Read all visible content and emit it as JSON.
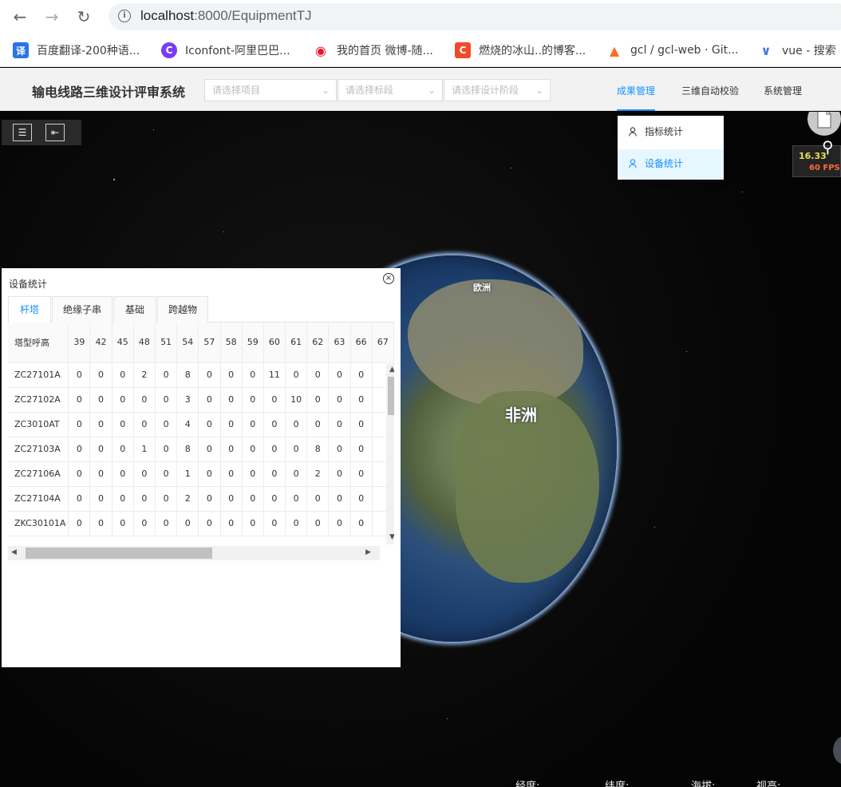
{
  "browser": {
    "url_host": "localhost",
    "url_path": ":8000/EquipmentTJ",
    "bookmarks": [
      {
        "label": "百度翻译-200种语...",
        "icon": "baidu-translate-icon",
        "color": "#2a73e8"
      },
      {
        "label": "Iconfont-阿里巴巴...",
        "icon": "iconfont-icon",
        "color": "#7b3cf2"
      },
      {
        "label": "我的首页 微博-随...",
        "icon": "weibo-icon",
        "color": "#e6162d"
      },
      {
        "label": "燃烧的冰山..的博客...",
        "icon": "csdn-icon",
        "color": "#f04a2a"
      },
      {
        "label": "gcl / gcl-web · Git...",
        "icon": "gitlab-icon",
        "color": "#fc6d26"
      },
      {
        "label": "vue - 搜索",
        "icon": "vue-search-icon",
        "color": "#3b7de8"
      }
    ]
  },
  "header": {
    "title": "输电线路三维设计评审系统",
    "selects": {
      "project_placeholder": "请选择项目",
      "section_placeholder": "请选择标段",
      "stage_placeholder": "请选择设计阶段"
    },
    "menu": {
      "results": "成果管理",
      "auto_check": "三维自动校验",
      "system": "系统管理"
    }
  },
  "dropdown": {
    "items": [
      {
        "label": "指标统计"
      },
      {
        "label": "设备统计"
      }
    ]
  },
  "map": {
    "labels": {
      "africa": "非洲",
      "europe": "欧洲"
    },
    "fps_value": "16.33",
    "fps_label": "60 FPS",
    "coords": {
      "lon": "经度:",
      "lat": "纬度:",
      "alt": "海拔:",
      "view": "视高:"
    }
  },
  "panel": {
    "title": "设备统计",
    "tabs": [
      "杆塔",
      "绝缘子串",
      "基础",
      "跨越物"
    ],
    "table": {
      "corner": "塔型呼高",
      "columns": [
        "39",
        "42",
        "45",
        "48",
        "51",
        "54",
        "57",
        "58",
        "59",
        "60",
        "61",
        "62",
        "63",
        "66",
        "67"
      ],
      "rows": [
        {
          "name": "ZC27101A",
          "values": [
            "0",
            "0",
            "0",
            "2",
            "0",
            "8",
            "0",
            "0",
            "0",
            "11",
            "0",
            "0",
            "0",
            "0",
            ""
          ]
        },
        {
          "name": "ZC27102A",
          "values": [
            "0",
            "0",
            "0",
            "0",
            "0",
            "3",
            "0",
            "0",
            "0",
            "0",
            "10",
            "0",
            "0",
            "0",
            ""
          ]
        },
        {
          "name": "ZC3010AT",
          "values": [
            "0",
            "0",
            "0",
            "0",
            "0",
            "4",
            "0",
            "0",
            "0",
            "0",
            "0",
            "0",
            "0",
            "0",
            ""
          ]
        },
        {
          "name": "ZC27103A",
          "values": [
            "0",
            "0",
            "0",
            "1",
            "0",
            "8",
            "0",
            "0",
            "0",
            "0",
            "0",
            "8",
            "0",
            "0",
            ""
          ]
        },
        {
          "name": "ZC27106A",
          "values": [
            "0",
            "0",
            "0",
            "0",
            "0",
            "1",
            "0",
            "0",
            "0",
            "0",
            "0",
            "2",
            "0",
            "0",
            ""
          ]
        },
        {
          "name": "ZC27104A",
          "values": [
            "0",
            "0",
            "0",
            "0",
            "0",
            "2",
            "0",
            "0",
            "0",
            "0",
            "0",
            "0",
            "0",
            "0",
            ""
          ]
        },
        {
          "name": "ZKC30101A",
          "values": [
            "0",
            "0",
            "0",
            "0",
            "0",
            "0",
            "0",
            "0",
            "0",
            "0",
            "0",
            "0",
            "0",
            "0",
            ""
          ]
        }
      ]
    }
  }
}
